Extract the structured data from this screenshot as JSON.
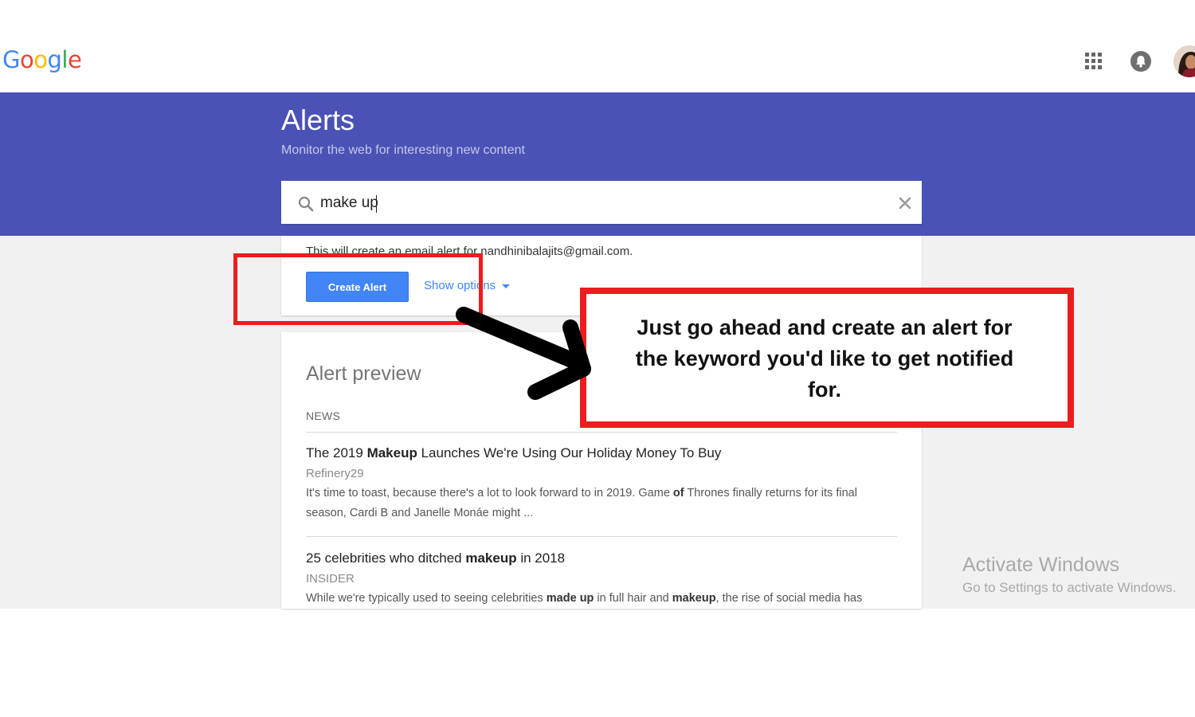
{
  "topbar": {
    "logo_letters": [
      {
        "char": "G",
        "color": "#4285f4"
      },
      {
        "char": "o",
        "color": "#ea4335"
      },
      {
        "char": "o",
        "color": "#fbbc05"
      },
      {
        "char": "g",
        "color": "#4285f4"
      },
      {
        "char": "l",
        "color": "#34a853"
      },
      {
        "char": "e",
        "color": "#ea4335"
      }
    ],
    "icons": [
      "apps-grid-icon",
      "notifications-bell-icon",
      "user-avatar"
    ]
  },
  "header": {
    "title": "Alerts",
    "subtitle": "Monitor the web for interesting new content",
    "band_color": "#4a52b5"
  },
  "search": {
    "value": "make up",
    "icon": "search-icon",
    "clear_icon": "close-icon"
  },
  "create": {
    "email_note": "This will create an email alert for nandhinibalajits@gmail.com.",
    "button_label": "Create Alert",
    "show_options_label": "Show options",
    "accent": "#4285f4"
  },
  "preview": {
    "title": "Alert preview",
    "section": "NEWS",
    "articles": [
      {
        "title_before": "The 2019 ",
        "title_bold": "Makeup",
        "title_after": " Launches We're Using Our Holiday Money To Buy",
        "source": "Refinery29",
        "snippet_1": "It's time to toast, because there's a lot to look forward to in 2019. Game ",
        "snippet_bold": "of",
        "snippet_2": " Thrones finally returns for its final season, Cardi B and Janelle Monáe might ..."
      },
      {
        "title_before": "25 celebrities who ditched ",
        "title_bold": "makeup",
        "title_after": " in 2018",
        "source": "INSIDER",
        "snippet_1": "While we're typically used to seeing celebrities ",
        "snippet_bold": "made up",
        "snippet_2": " in full hair and ",
        "snippet_bold_2": "makeup",
        "snippet_3": ", the rise of social media has"
      }
    ]
  },
  "watermark": {
    "title": "Activate Windows",
    "subtitle": "Go to Settings to activate Windows."
  },
  "annotation": {
    "callout_text": "Just go ahead and create an alert for the keyword you'd like to get notified for.",
    "highlight_color": "#ee1c1c"
  }
}
